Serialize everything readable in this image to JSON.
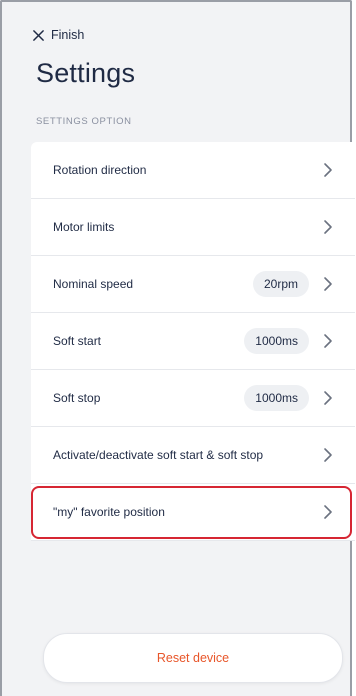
{
  "header": {
    "finish_label": "Finish",
    "title": "Settings",
    "section_label": "SETTINGS OPTION"
  },
  "settings": {
    "items": [
      {
        "label": "Rotation direction",
        "value": null
      },
      {
        "label": "Motor limits",
        "value": null
      },
      {
        "label": "Nominal speed",
        "value": "20rpm"
      },
      {
        "label": "Soft start",
        "value": "1000ms"
      },
      {
        "label": "Soft stop",
        "value": "1000ms"
      },
      {
        "label": "Activate/deactivate soft start & soft stop",
        "value": null
      },
      {
        "label": "\"my\" favorite position",
        "value": null
      }
    ]
  },
  "footer": {
    "reset_label": "Reset device"
  },
  "colors": {
    "background": "#f2f3f5",
    "text": "#1f2a44",
    "accent": "#e8562a",
    "highlight": "#d62633"
  }
}
